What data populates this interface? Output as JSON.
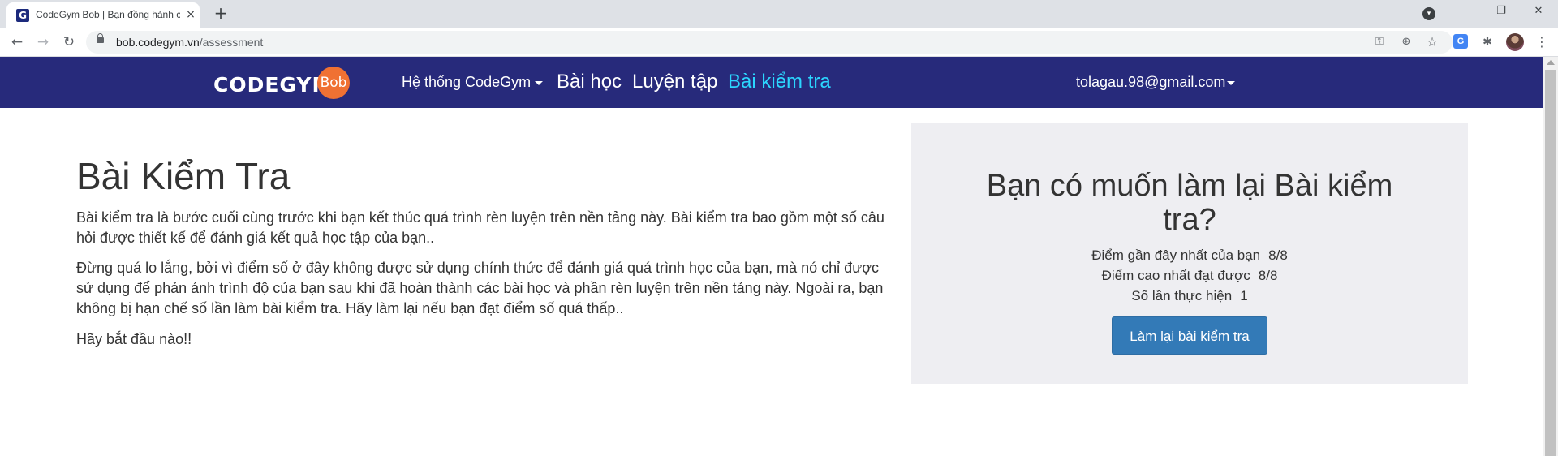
{
  "browser": {
    "tab_title": "CodeGym Bob | Bạn đồng hành c",
    "tab_favicon_letter": "G",
    "tab_close_icon": "×",
    "new_tab_icon": "+",
    "url_host": "bob.codegym.vn",
    "url_path": "/assessment",
    "back_icon": "←",
    "forward_icon": "→",
    "reload_icon": "↻",
    "tab_search_icon": "▾",
    "minimize_icon": "–",
    "maximize_icon": "❐",
    "close_window_icon": "✕",
    "key_icon": "⚿",
    "zoom_icon": "⊕",
    "star_icon": "☆",
    "translate_ext_icon": "G",
    "extensions_icon": "✱",
    "menu_icon": "⋮"
  },
  "site_nav": {
    "logo_text": "CODEGYM",
    "logo_badge": "Bob",
    "dropdown_label": "Hệ thống CodeGym",
    "links": [
      "Bài học",
      "Luyện tập",
      "Bài kiểm tra"
    ],
    "active_link": "Bài kiểm tra",
    "user_email": "tolagau.98@gmail.com",
    "colors": {
      "background": "#272a7b",
      "active": "#2bd6ff",
      "logo_badge": "#f07133"
    }
  },
  "main": {
    "title": "Bài Kiểm Tra",
    "paragraphs": [
      "Bài kiểm tra là bước cuối cùng trước khi bạn kết thúc quá trình rèn luyện trên nền tảng này. Bài kiểm tra bao gồm một số câu hỏi được thiết kế để đánh giá kết quả học tập của bạn..",
      "Đừng quá lo lắng, bởi vì điểm số ở đây không được sử dụng chính thức để đánh giá quá trình học của bạn, mà nó chỉ được sử dụng để phản ánh trình độ của bạn sau khi đã hoàn thành các bài học và phần rèn luyện trên nền tảng này. Ngoài ra, bạn không bị hạn chế số lần làm bài kiểm tra. Hãy làm lại nếu bạn đạt điểm số quá thấp..",
      "Hãy bắt đầu nào!!"
    ]
  },
  "panel": {
    "title": "Bạn có muốn làm lại Bài kiểm tra?",
    "stats": [
      {
        "label": "Điểm gần đây nhất của bạn",
        "value": "8/8"
      },
      {
        "label": "Điểm cao nhất đạt được",
        "value": "8/8"
      },
      {
        "label": "Số lần thực hiện",
        "value": "1"
      }
    ],
    "button_label": "Làm lại bài kiểm tra",
    "colors": {
      "background": "#eeeef2",
      "button": "#337ab7"
    }
  }
}
